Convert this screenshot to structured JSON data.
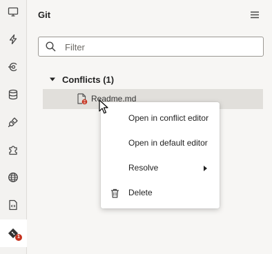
{
  "panel": {
    "title": "Git",
    "menu_icon": "hamburger-menu-icon"
  },
  "filter": {
    "placeholder": "Filter",
    "value": ""
  },
  "conflicts": {
    "label": "Conflicts (1)",
    "files": [
      "Readme.md"
    ]
  },
  "context_menu": {
    "items": [
      {
        "label": "Open in conflict editor"
      },
      {
        "label": "Open in default editor"
      },
      {
        "label": "Resolve",
        "has_submenu": true
      },
      {
        "label": "Delete",
        "icon": "trash-icon"
      }
    ]
  },
  "activity_bar": {
    "items": [
      "monitor-icon",
      "lightning-icon",
      "service-icon",
      "database-icon",
      "plug-icon",
      "puzzle-icon",
      "globe-icon",
      "document-code-icon",
      "git-icon"
    ],
    "git_badge": "1"
  },
  "colors": {
    "selection": "#e1dfdb",
    "badge": "#c5331f"
  }
}
